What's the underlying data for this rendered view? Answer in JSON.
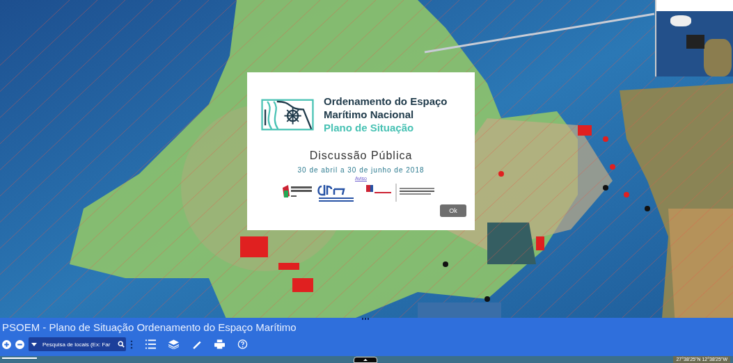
{
  "dialog": {
    "title_lines": [
      "Ordenamento do Espaço",
      "Marítimo Nacional"
    ],
    "subtitle": "Plano de Situação",
    "heading": "Discussão Pública",
    "dates": "30 de abril a 30 de junho de 2018",
    "link": "Aviso",
    "button": "Ok"
  },
  "app_bar": {
    "title": "PSOEM - Plano de Situação Ordenamento do Espaço Marítimo",
    "search": {
      "placeholder": "Pesquisa de locais (Ex: Far"
    }
  },
  "coordinates": "27°38'25\"N 12°38'25\"W"
}
